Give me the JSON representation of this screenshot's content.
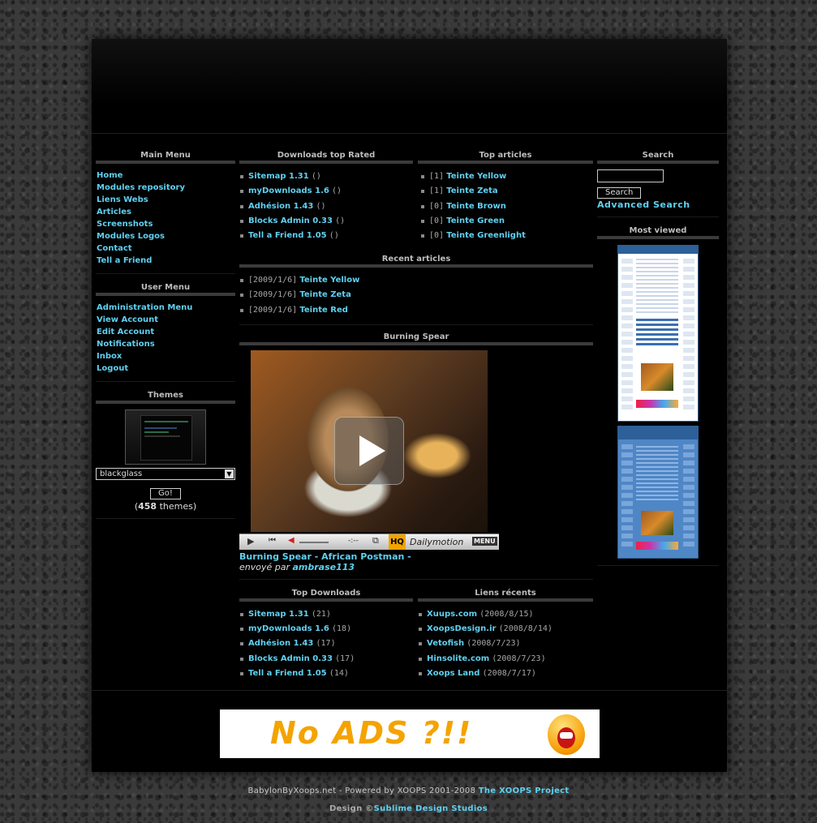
{
  "main_menu": {
    "title": "Main Menu",
    "items": [
      "Home",
      "Modules repository",
      "Liens Webs",
      "Articles",
      "Screenshots",
      "Modules Logos",
      "Contact",
      "Tell a Friend"
    ]
  },
  "user_menu": {
    "title": "User Menu",
    "items": [
      "Administration Menu",
      "View Account",
      "Edit Account",
      "Notifications",
      "Inbox",
      "Logout"
    ]
  },
  "themes": {
    "title": "Themes",
    "selected": "blackglass",
    "go_label": "Go!",
    "count_open": "(",
    "count_value": "458",
    "count_suffix": " themes)"
  },
  "downloads_top_rated": {
    "title": "Downloads top Rated",
    "items": [
      {
        "name": "Sitemap 1.31",
        "extra": "()"
      },
      {
        "name": "myDownloads 1.6",
        "extra": "()"
      },
      {
        "name": "Adhésion 1.43",
        "extra": "()"
      },
      {
        "name": "Blocks Admin 0.33",
        "extra": "()"
      },
      {
        "name": "Tell a Friend 1.05",
        "extra": "()"
      }
    ]
  },
  "top_articles": {
    "title": "Top articles",
    "items": [
      {
        "count": "[1]",
        "name": "Teinte Yellow"
      },
      {
        "count": "[1]",
        "name": "Teinte Zeta"
      },
      {
        "count": "[0]",
        "name": "Teinte Brown"
      },
      {
        "count": "[0]",
        "name": "Teinte Green"
      },
      {
        "count": "[0]",
        "name": "Teinte Greenlight"
      }
    ]
  },
  "recent_articles": {
    "title": "Recent articles",
    "items": [
      {
        "date": "[2009/1/6]",
        "name": "Teinte Yellow"
      },
      {
        "date": "[2009/1/6]",
        "name": "Teinte Zeta"
      },
      {
        "date": "[2009/1/6]",
        "name": "Teinte Red"
      }
    ]
  },
  "video": {
    "title": "Burning Spear",
    "caption": "Burning Spear - African Postman -",
    "sent_by": "envoyé par",
    "author": "ambrase113",
    "player_time": "-:--",
    "hq": "HQ",
    "brand": "Dailymotion",
    "menu": "MENU"
  },
  "top_downloads": {
    "title": "Top Downloads",
    "items": [
      {
        "name": "Sitemap 1.31",
        "extra": "(21)"
      },
      {
        "name": "myDownloads 1.6",
        "extra": "(18)"
      },
      {
        "name": "Adhésion 1.43",
        "extra": "(17)"
      },
      {
        "name": "Blocks Admin 0.33",
        "extra": "(17)"
      },
      {
        "name": "Tell a Friend 1.05",
        "extra": "(14)"
      }
    ]
  },
  "liens_recents": {
    "title": "Liens récents",
    "items": [
      {
        "name": "Xuups.com",
        "extra": "(2008/8/15)"
      },
      {
        "name": "XoopsDesign.ir",
        "extra": "(2008/8/14)"
      },
      {
        "name": "Vetofish",
        "extra": "(2008/7/23)"
      },
      {
        "name": "Hinsolite.com",
        "extra": "(2008/7/23)"
      },
      {
        "name": "Xoops Land",
        "extra": "(2008/7/17)"
      }
    ]
  },
  "search": {
    "title": "Search",
    "button": "Search",
    "advanced": "Advanced Search",
    "value": ""
  },
  "most_viewed": {
    "title": "Most viewed"
  },
  "ad": {
    "text": "No ADS ?!!"
  },
  "footer": {
    "line1_text": "BabylonByXoops.net - Powered by XOOPS 2001-2008 ",
    "line1_link": "The XOOPS Project",
    "line2_text": "Design ©",
    "line2_link": "Sublime Design Studios"
  },
  "colors": {
    "link": "#5fd0f0",
    "background": "#000000",
    "text": "#cfcfcf"
  }
}
